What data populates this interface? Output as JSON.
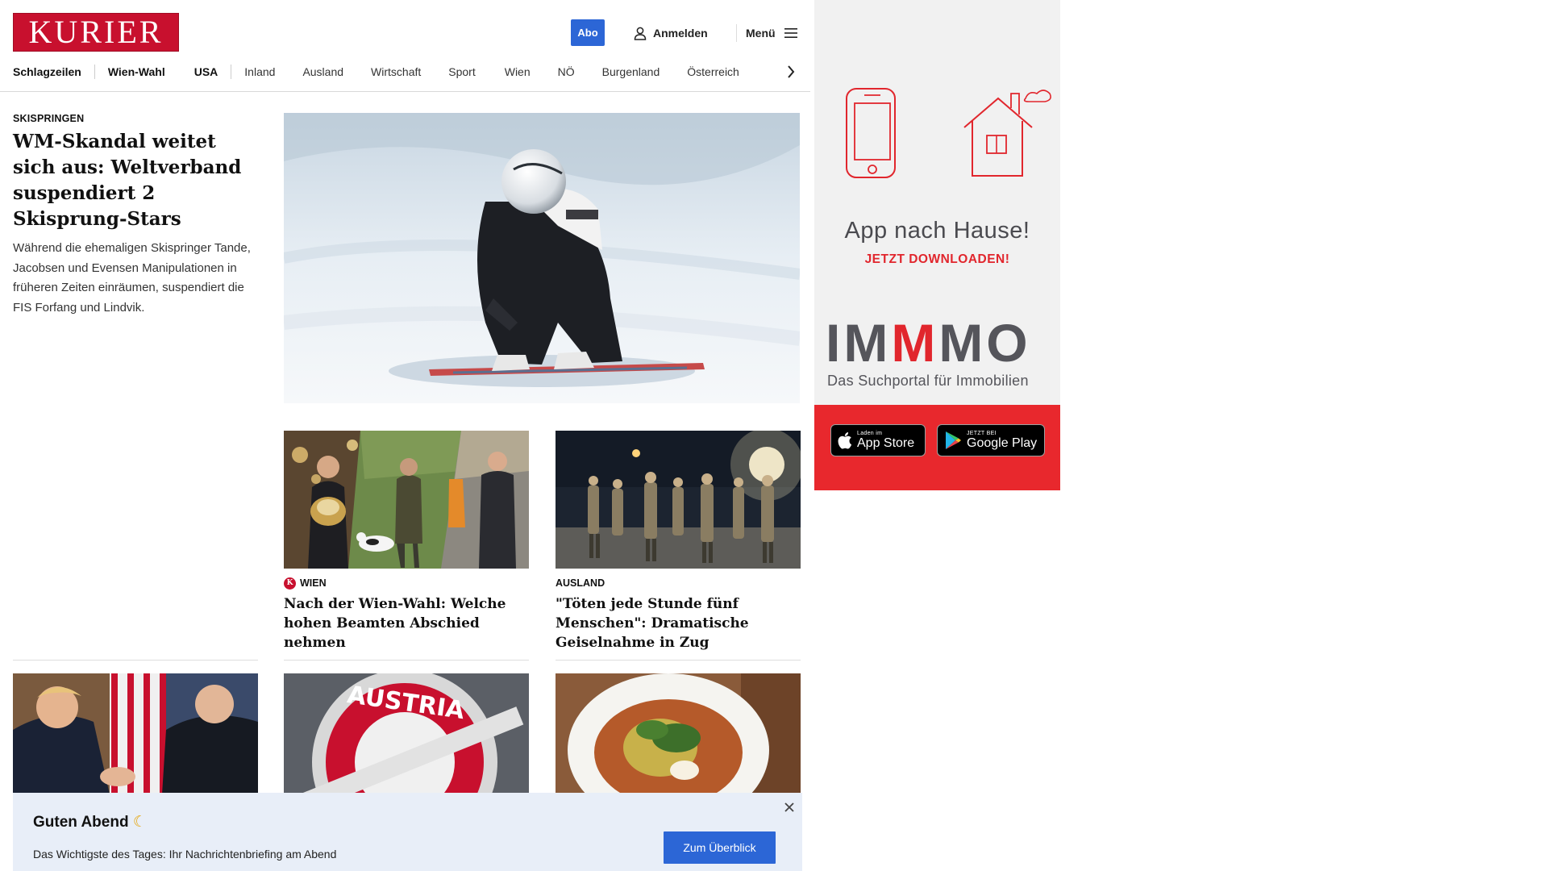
{
  "header": {
    "logo_text": "KURIER",
    "abo_label": "Abo",
    "login_label": "Anmelden",
    "menu_label": "Menü"
  },
  "nav": {
    "items": [
      "Schlagzeilen",
      "Wien-Wahl",
      "USA",
      "Inland",
      "Ausland",
      "Wirtschaft",
      "Sport",
      "Wien",
      "NÖ",
      "Burgenland",
      "Österreich"
    ]
  },
  "hero": {
    "kicker": "SKISPRINGEN",
    "title": "WM-Skandal weitet sich aus: Weltverband suspendiert 2 Skisprung-Stars",
    "lead": "Während die ehemaligen Skispringer Tande, Jacobsen und Evensen Manipulationen in früheren Zeiten einräumen, suspendiert die FIS Forfang und Lindvik."
  },
  "teasers": [
    {
      "kicker": "WIEN",
      "title": "Nach der Wien-Wahl: Welche hohen Beamten Abschied nehmen"
    },
    {
      "kicker": "AUSLAND",
      "title": "\"Töten jede Stunde fünf Menschen\": Dramatische Geiselnahme in Zug"
    }
  ],
  "briefing": {
    "greeting": "Guten Abend",
    "description": "Das Wichtigste des Tages: Ihr Nachrichtenbriefing am Abend",
    "cta_label": "Zum Überblick"
  },
  "ad": {
    "headline": "App nach Hause!",
    "subline": "JETZT DOWNLOADEN!",
    "brand_pre": "IM",
    "brand_m": "M",
    "brand_post": "MO",
    "tagline": "Das Suchportal für Immobilien",
    "appstore_small": "Laden im",
    "appstore_big": "App Store",
    "googleplay_small": "JETZT BEI",
    "googleplay_big": "Google Play"
  },
  "colors": {
    "brand_red": "#c8102e",
    "accent_blue": "#2c66d6",
    "ad_red": "#e8282d",
    "briefing_bg": "#e8eef8"
  },
  "icons": [
    "user-icon",
    "hamburger-icon",
    "chevron-right-icon",
    "close-icon",
    "moon-icon",
    "apple-icon",
    "google-play-icon",
    "smartphone-icon",
    "house-icon"
  ]
}
